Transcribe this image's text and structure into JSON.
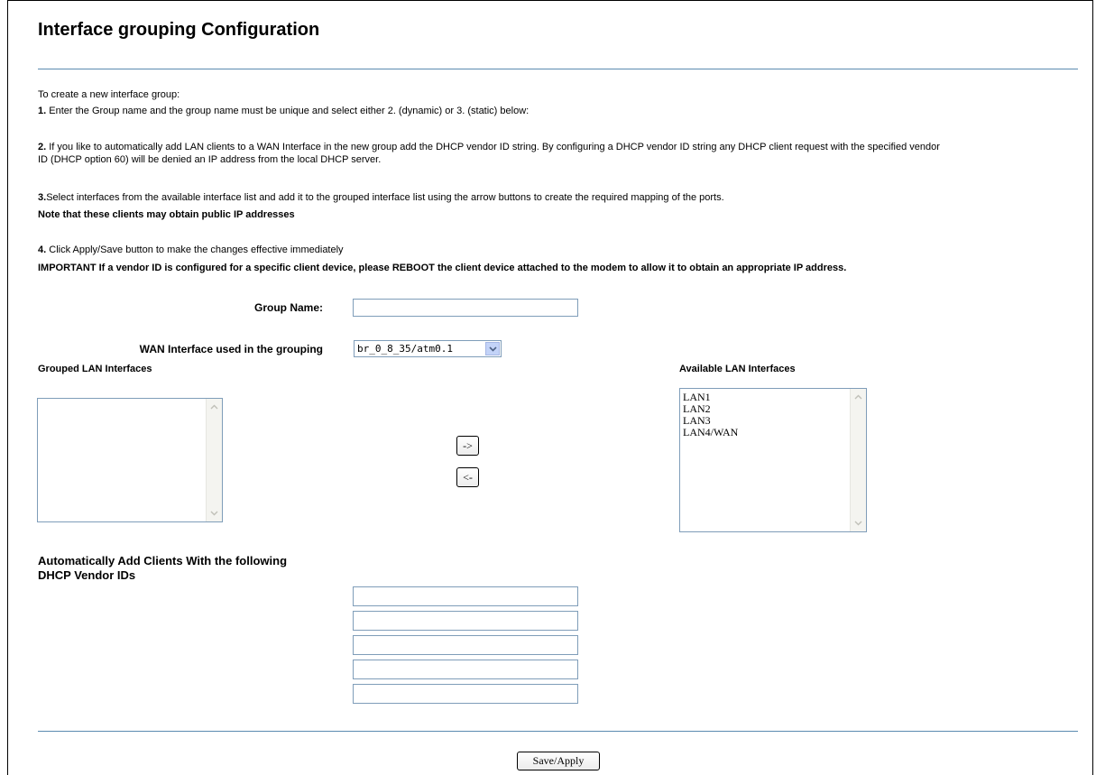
{
  "page": {
    "title": "Interface grouping Configuration"
  },
  "instructions": {
    "intro": "To create a new interface group:",
    "step1_num": "1.",
    "step1_text": " Enter the Group name and the group name must be unique and select either 2. (dynamic) or 3. (static) below:",
    "step2_num": "2.",
    "step2_text_line1": " If you like to automatically add LAN clients to a WAN Interface in the new group add the DHCP vendor ID string. By configuring a DHCP vendor ID string any DHCP client request with the specified vendor",
    "step2_text_line2": "ID (DHCP option 60) will be denied an IP address from the local DHCP server.",
    "step3_num": "3.",
    "step3_text": "Select interfaces from the available interface list and add it to the grouped interface list using the arrow buttons to create the required mapping of the ports.",
    "note": "Note that these clients may obtain public IP addresses",
    "step4_num": "4.",
    "step4_text": " Click Apply/Save button to make the changes effective immediately",
    "important": "IMPORTANT If a vendor ID is configured for a specific client device, please REBOOT the client device attached to the modem to allow it to obtain an appropriate IP address."
  },
  "form": {
    "group_name_label": "Group Name:",
    "group_name_value": "",
    "wan_label": "WAN Interface used in the grouping",
    "wan_selected": "br_0_8_35/atm0.1",
    "grouped_label": "Grouped LAN Interfaces",
    "available_label": "Available LAN Interfaces",
    "available_items": [
      "LAN1",
      "LAN2",
      "LAN3",
      "LAN4/WAN"
    ],
    "move_right_label": "->",
    "move_left_label": "<-",
    "vendor_heading_line1": "Automatically Add Clients With the following",
    "vendor_heading_line2": "DHCP Vendor IDs",
    "vendor_ids": [
      "",
      "",
      "",
      "",
      ""
    ],
    "save_label": "Save/Apply"
  },
  "colors": {
    "divider": "#5b8bb0",
    "input_border": "#7f9db9",
    "dropdown_button": "#c3d3f8"
  }
}
